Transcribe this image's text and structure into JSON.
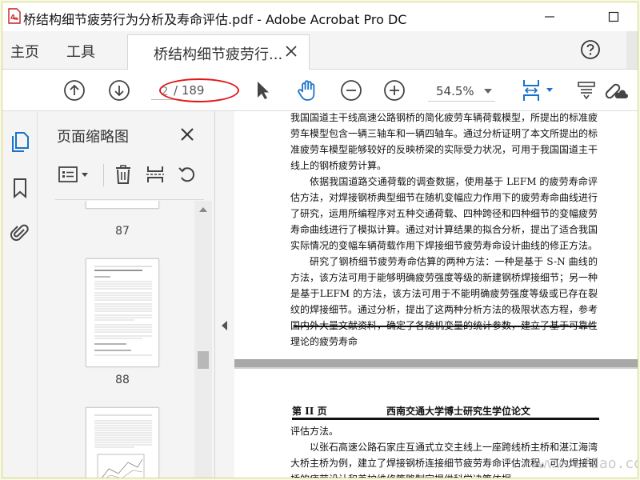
{
  "window": {
    "title": "桥结构细节疲劳行为分析及寿命评估.pdf - Adobe Acrobat Pro DC"
  },
  "menubar": {
    "home": "主页",
    "tools": "工具",
    "doc_tab": "桥结构细节疲劳行..."
  },
  "toolbar": {
    "page_current": "2",
    "page_total": "/ 189",
    "zoom": "54.5%",
    "highlight_color": "#e01818"
  },
  "panel": {
    "title": "页面缩略图",
    "thumbnails": [
      {
        "label": "87"
      },
      {
        "label": "88"
      }
    ]
  },
  "document": {
    "page1_paragraphs": [
      "我国国道主干线高速公路钢桥的简化疲劳车辆荷载模型，所提出的标准疲劳车模型包含一辆三轴车和一辆四轴车。通过分析证明了本文所提出的标准疲劳车模型能够较好的反映桥梁的实际受力状况，可用于我国国道主干线上的钢桥疲劳计算。",
      "依据我国道路交通荷载的调查数据，使用基于 LEFM 的疲劳寿命评估方法，对焊接钢桥典型细节在随机变幅应力作用下的疲劳寿命曲线进行了研究，运用所编程序对五种交通荷载、四种跨径和四种细节的变幅疲劳寿命曲线进行了模拟计算。通过对计算结果的拟合分析，提出了适合我国实际情况的变幅车辆荷载作用下焊接细节疲劳寿命设计曲线的修正方法。",
      "研究了钢桥细节疲劳寿命估算的两种方法：一种是基于 S-N 曲线的方法，该方法可用于能够明确疲劳强度等级的新建钢桥焊接细节；另一种是基于LEFM 的方法，该方法可用于不能明确疲劳强度等级或已存在裂纹的焊接细节。通过分析，提出了这两种分析方法的极限状态方程，参考国内外大量文献资料，确定了各随机变量的统计参数，建立了基于可靠性理论的疲劳寿命"
    ],
    "page2_header_left": "第 II 页",
    "page2_header_right": "西南交通大学博士研究生学位论文",
    "page2_paragraphs": [
      "评估方法。",
      "以张石高速公路石家庄互通式立交主线上一座跨线桥主桥和湛江海湾大桥主桥为例，建立了焊接钢桥连接细节疲劳寿命评估流程，可为焊接钢桥的疲劳设计和养护维修策略制定提供科学决策依据。"
    ]
  },
  "watermark": "www.cfdao.com",
  "icons": {
    "app": "acrobat-pdf-icon",
    "prev_page": "arrow-up-circle-icon",
    "next_page": "arrow-down-circle-icon",
    "select": "cursor-arrow-icon",
    "hand": "hand-icon",
    "zoom_out": "minus-circle-icon",
    "zoom_in": "plus-circle-icon",
    "fit": "fit-page-icon",
    "comment": "comment-tool-icon",
    "share": "link-cloud-icon",
    "help": "help-icon"
  }
}
